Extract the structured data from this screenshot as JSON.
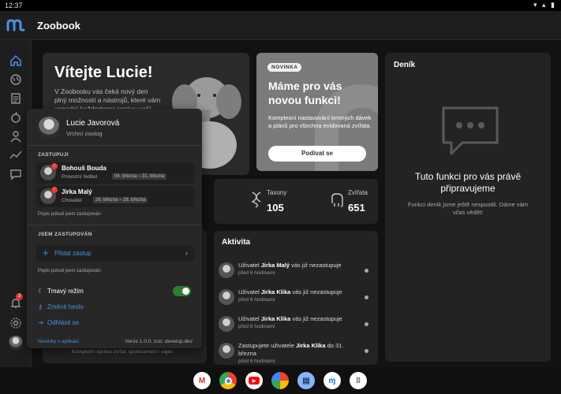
{
  "status_bar": {
    "time": "12:37"
  },
  "app": {
    "title": "Zoobook"
  },
  "welcome": {
    "title": "Vítejte Lucie!",
    "text": "V Zoobooku vás čeká nový den plný možností a nástrojů, které vám usnadní každodenní správu vaší"
  },
  "new_feature": {
    "badge": "NOVINKA",
    "title": "Máme pro vás novou funkci!",
    "text": "Komplexní nastavování krmných dávek a plánů pro všechna evidovaná zvířata.",
    "button": "Podívat se"
  },
  "diary": {
    "title": "Deník",
    "headline": "Tuto funkci pro vás právě připravujeme",
    "text": "Funkci deník jsme ještě nespustili. Dáme vám včas vědět!"
  },
  "stats": [
    {
      "label": "Taxony",
      "value": "105"
    },
    {
      "label": "Zvířata",
      "value": "651"
    }
  ],
  "activity": {
    "title": "Aktivita",
    "items": [
      {
        "prefix": "Uživatel ",
        "name": "Jirka Malý",
        "suffix": " vás již nezastupuje",
        "time": "před 6 hodinami"
      },
      {
        "prefix": "Uživatel ",
        "name": "Jirka Klika",
        "suffix": " vás již nezastupuje",
        "time": "před 6 hodinami"
      },
      {
        "prefix": "Uživatel ",
        "name": "Jirka Klika",
        "suffix": " vás již nezastupuje",
        "time": "před 6 hodinami"
      },
      {
        "prefix": "Zastupujete uživatele ",
        "name": "Jirka Klika",
        "suffix": " do 31. března",
        "time": "před 6 hodinami"
      }
    ]
  },
  "background_text": "Kompletní správa zvířat, společenství i vajec",
  "profile_popup": {
    "name": "Lucie Javorová",
    "role": "Vrchní zoolog",
    "represent_heading": "ZASTUPUJI",
    "represent": [
      {
        "name": "Bohouš Bouda",
        "role": "Provozní ředitel",
        "dates": "04. března – 31. března",
        "badge": "!"
      },
      {
        "name": "Jirka Malý",
        "role": "Chovatel",
        "dates": "26. března – 28. března",
        "badge": "!"
      }
    ],
    "represent_note": "Popis pokud jsem zastupován",
    "represented_by_heading": "JSEM ZASTUPOVÁN",
    "add_substitute": "Přidat zástup",
    "represented_note": "Popis pokud jsem zastupován",
    "dark_mode": "Tmavý režim",
    "dark_mode_on": true,
    "change_password": "Změnit heslo",
    "logout": "Odhlásit se",
    "news_link": "Novinky v aplikaci",
    "version": "Verze 1.0.0, zoo: develop.dev"
  },
  "notification_count": "3",
  "colors": {
    "accent": "#4a90e2",
    "toggle_on": "#2e7d32",
    "badge_red": "#e53935"
  },
  "dock": [
    "gmail-icon",
    "chrome-icon",
    "youtube-icon",
    "photos-icon",
    "messages-icon",
    "zoobook-icon",
    "apps-icon"
  ]
}
